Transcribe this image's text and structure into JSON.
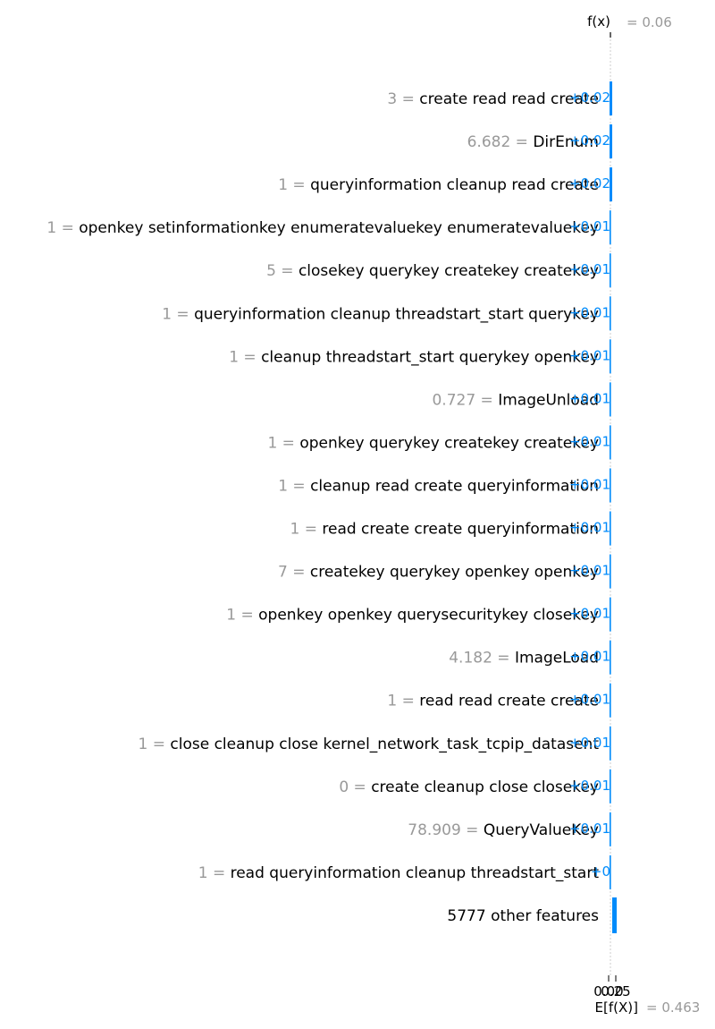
{
  "chart_data": {
    "type": "waterfall",
    "title": "",
    "fx_label": "f(x)",
    "fx_value_text": "= 0.06",
    "fx": 0.06,
    "base_label": "E[f(X)]",
    "base_value_text": "= 0.463",
    "base_value": 0.463,
    "xlabel": "",
    "x_tick_labels": [
      "0.00",
      "0.25"
    ],
    "positive_color": "#008bfb",
    "rows": [
      {
        "value": "3",
        "name": "create read read create",
        "shap": 0.02,
        "label": "+0.02"
      },
      {
        "value": "6.682",
        "name": "DirEnum",
        "shap": 0.02,
        "label": "+0.02"
      },
      {
        "value": "1",
        "name": "queryinformation cleanup read create",
        "shap": 0.02,
        "label": "+0.02"
      },
      {
        "value": "1",
        "name": "openkey setinformationkey enumeratevaluekey enumeratevaluekey",
        "shap": 0.01,
        "label": "+0.01"
      },
      {
        "value": "5",
        "name": "closekey querykey createkey createkey",
        "shap": 0.01,
        "label": "+0.01"
      },
      {
        "value": "1",
        "name": "queryinformation cleanup threadstart_start querykey",
        "shap": 0.01,
        "label": "+0.01"
      },
      {
        "value": "1",
        "name": "cleanup threadstart_start querykey openkey",
        "shap": 0.01,
        "label": "+0.01"
      },
      {
        "value": "0.727",
        "name": "ImageUnload",
        "shap": 0.01,
        "label": "+0.01"
      },
      {
        "value": "1",
        "name": "openkey querykey createkey createkey",
        "shap": 0.01,
        "label": "+0.01"
      },
      {
        "value": "1",
        "name": "cleanup read create queryinformation",
        "shap": 0.01,
        "label": "+0.01"
      },
      {
        "value": "1",
        "name": "read create create queryinformation",
        "shap": 0.01,
        "label": "+0.01"
      },
      {
        "value": "7",
        "name": "createkey querykey openkey openkey",
        "shap": 0.01,
        "label": "+0.01"
      },
      {
        "value": "1",
        "name": "openkey openkey querysecuritykey closekey",
        "shap": 0.01,
        "label": "+0.01"
      },
      {
        "value": "4.182",
        "name": "ImageLoad",
        "shap": 0.01,
        "label": "+0.01"
      },
      {
        "value": "1",
        "name": "read read create create",
        "shap": 0.01,
        "label": "+0.01"
      },
      {
        "value": "1",
        "name": "close cleanup close kernel_network_task_tcpip_datasent",
        "shap": 0.01,
        "label": "+0.01"
      },
      {
        "value": "0",
        "name": "create cleanup close closekey",
        "shap": 0.01,
        "label": "+0.01"
      },
      {
        "value": "78.909",
        "name": "QueryValueKey",
        "shap": 0.01,
        "label": "+0.01"
      },
      {
        "value": "1",
        "name": "read queryinformation cleanup threadstart_start",
        "shap": 0.0,
        "label": "+0"
      },
      {
        "value": "",
        "name": "5777 other features",
        "shap": 0.02,
        "label": ""
      }
    ]
  }
}
